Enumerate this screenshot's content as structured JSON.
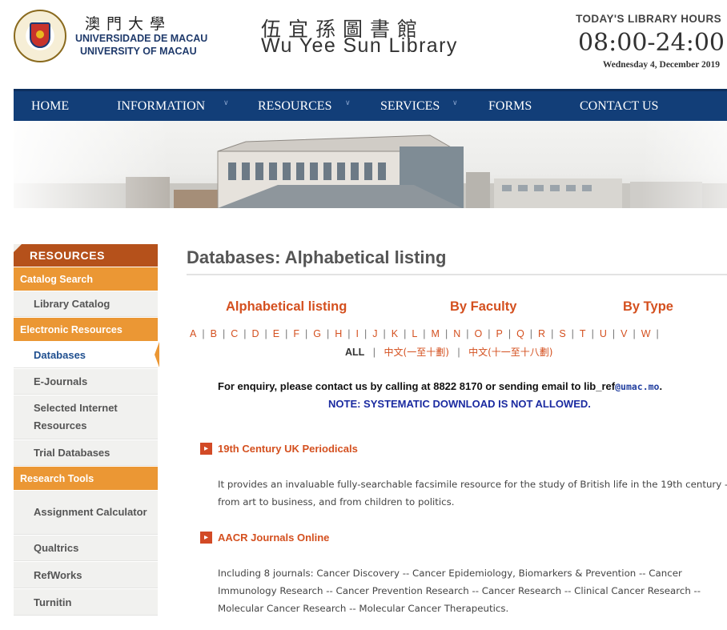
{
  "header": {
    "university_cn": "澳門大學",
    "university_pt": "UNIVERSIDADE DE MACAU",
    "university_en": "UNIVERSITY OF MACAU",
    "library_cn": "伍宜孫圖書館",
    "library_en": "Wu Yee Sun Library",
    "hours_title": "TODAY'S LIBRARY HOURS",
    "hours_time": "08:00-24:00",
    "hours_date": "Wednesday 4, December 2019",
    "seal_text": "UNIVERSIDADE DE MACAU 澳門大學"
  },
  "nav": {
    "items": [
      {
        "label": "HOME",
        "has_dropdown": false
      },
      {
        "label": "INFORMATION",
        "has_dropdown": true
      },
      {
        "label": "RESOURCES",
        "has_dropdown": true
      },
      {
        "label": "SERVICES",
        "has_dropdown": true
      },
      {
        "label": "FORMS",
        "has_dropdown": false
      },
      {
        "label": "CONTACT US",
        "has_dropdown": false
      }
    ]
  },
  "sidebar": {
    "heading": "RESOURCES",
    "groups": [
      {
        "label": "Catalog Search",
        "items": [
          "Library Catalog"
        ]
      },
      {
        "label": "Electronic Resources",
        "items": [
          "Databases",
          "E-Journals",
          "Selected Internet Resources",
          "Trial Databases"
        ]
      },
      {
        "label": "Research Tools",
        "items": [
          "Assignment Calculator",
          "Qualtrics",
          "RefWorks",
          "Turnitin"
        ]
      }
    ],
    "active_item": "Databases"
  },
  "main": {
    "title": "Databases: Alphabetical listing",
    "tabs": [
      "Alphabetical listing",
      "By Faculty",
      "By Type"
    ],
    "letters": [
      "A",
      "B",
      "C",
      "D",
      "E",
      "F",
      "G",
      "H",
      "I",
      "J",
      "K",
      "L",
      "M",
      "N",
      "O",
      "P",
      "Q",
      "R",
      "S",
      "T",
      "U",
      "V",
      "W"
    ],
    "all_label": "ALL",
    "cn_range_1": "中文(一至十劃)",
    "cn_range_2": "中文(十一至十八劃)",
    "enquiry_text": "For enquiry, please contact us by calling at 8822 8170 or sending email to lib_ref",
    "enquiry_email": "@umac.mo",
    "enquiry_end": ".",
    "note": "NOTE: SYSTEMATIC DOWNLOAD IS NOT ALLOWED.",
    "databases": [
      {
        "name": "19th Century UK Periodicals",
        "description": "It provides an invaluable fully-searchable facsimile resource for the study of British life in the 19th century - from art to business, and from children to politics."
      },
      {
        "name": "AACR Journals Online",
        "description": "Including 8 journals: Cancer Discovery -- Cancer Epidemiology, Biomarkers & Prevention -- Cancer Immunology Research -- Cancer Prevention Research -- Cancer Research -- Clinical Cancer Research -- Molecular Cancer Research -- Molecular Cancer Therapeutics."
      }
    ]
  },
  "colors": {
    "nav_bg": "#123e78",
    "accent_orange": "#eb9734",
    "heading_orange": "#b5511b",
    "link_red": "#d4501f",
    "note_blue": "#1a2aa0"
  },
  "icons": [
    "university-seal-icon",
    "dropdown-caret-icon",
    "bullet-arrow-icon"
  ]
}
